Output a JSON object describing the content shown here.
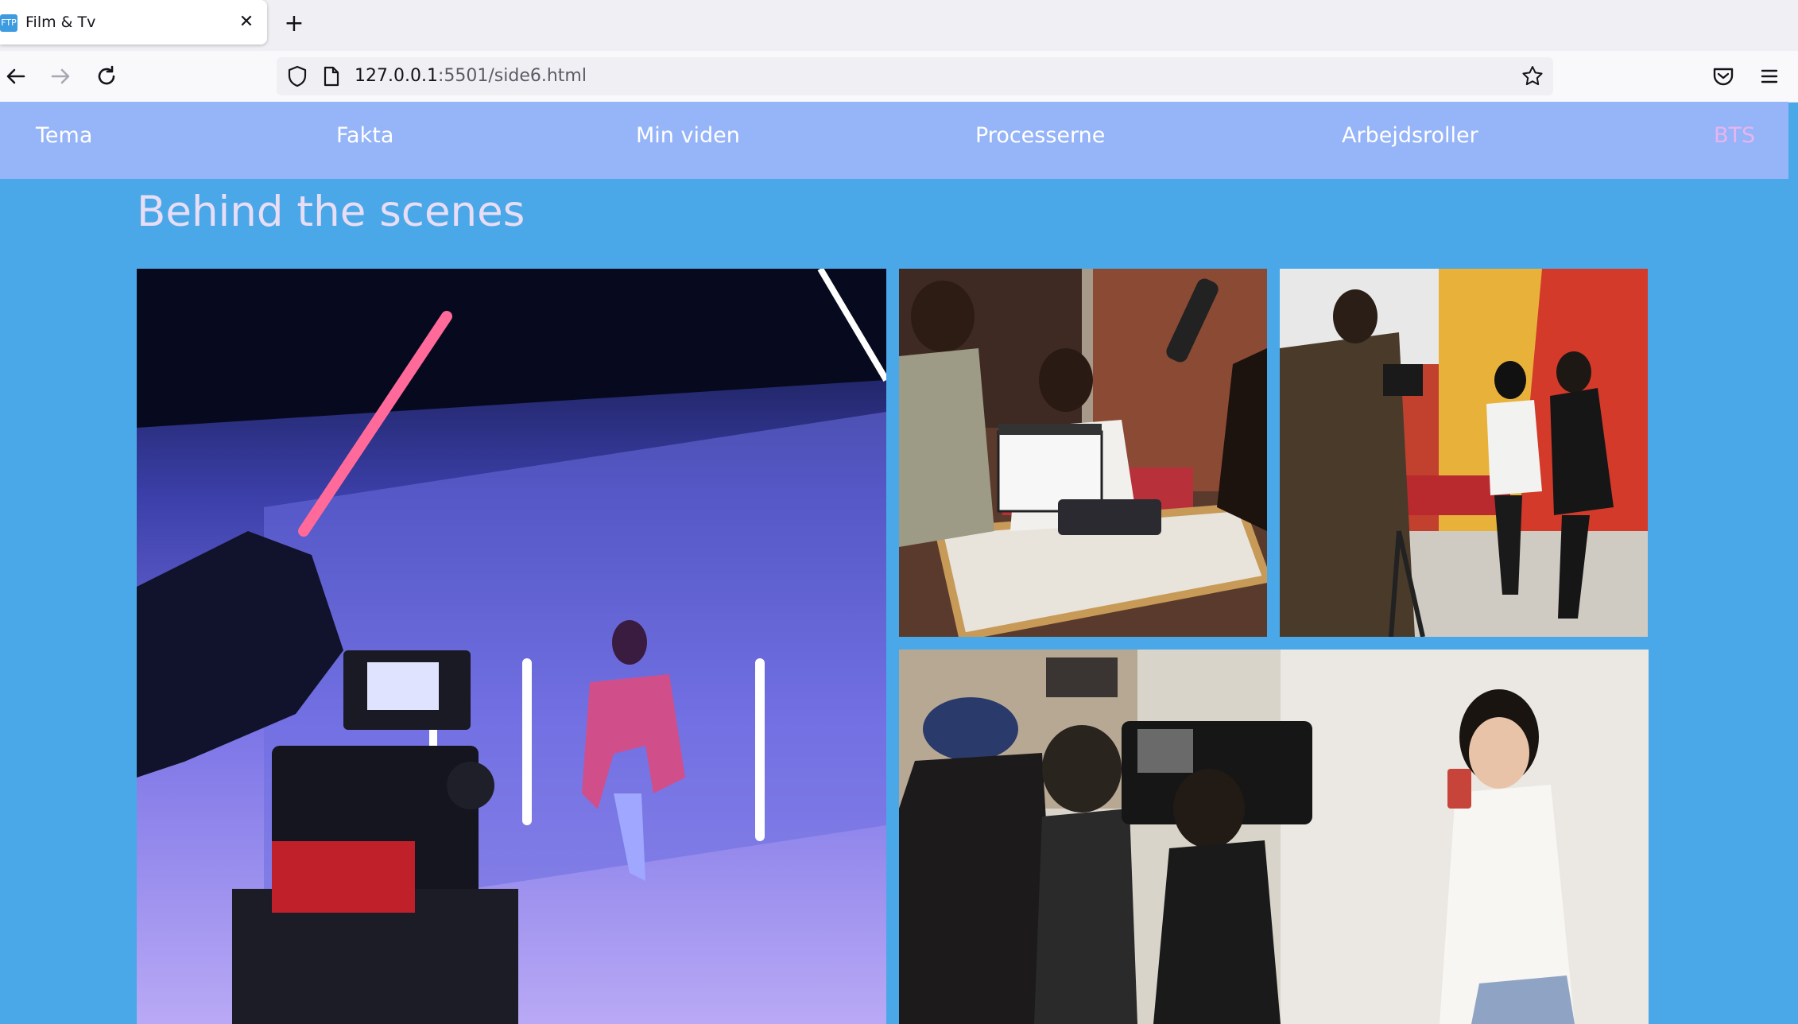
{
  "browser": {
    "tab": {
      "favicon_text": "FTP",
      "title": "Film & Tv",
      "close_glyph": "✕"
    },
    "new_tab_glyph": "+",
    "url": {
      "host": "127.0.0.1",
      "rest": ":5501/side6.html"
    },
    "icons": [
      "back-arrow-icon",
      "forward-arrow-icon",
      "reload-icon",
      "shield-icon",
      "page-icon",
      "bookmark-star-icon",
      "pocket-icon",
      "menu-icon"
    ]
  },
  "nav": {
    "items": [
      {
        "label": "Tema"
      },
      {
        "label": "Fakta"
      },
      {
        "label": "Min viden"
      },
      {
        "label": "Processerne"
      },
      {
        "label": "Arbejdsroller"
      },
      {
        "label": "BTS",
        "active": true
      }
    ],
    "background": "#96b4f8",
    "active_color": "#e8b4ee"
  },
  "main": {
    "title": "Behind the scenes",
    "background": "#4aa8e8",
    "photos": [
      {
        "subject": "camera operator filming a dancer in a neon-lit studio"
      },
      {
        "subject": "clapperboard held in front of an actress at a diner table"
      },
      {
        "subject": "camera operator filming two dancers in a red and yellow diner"
      },
      {
        "subject": "film crew with a camera rig filming a woman against a white wall"
      }
    ]
  }
}
